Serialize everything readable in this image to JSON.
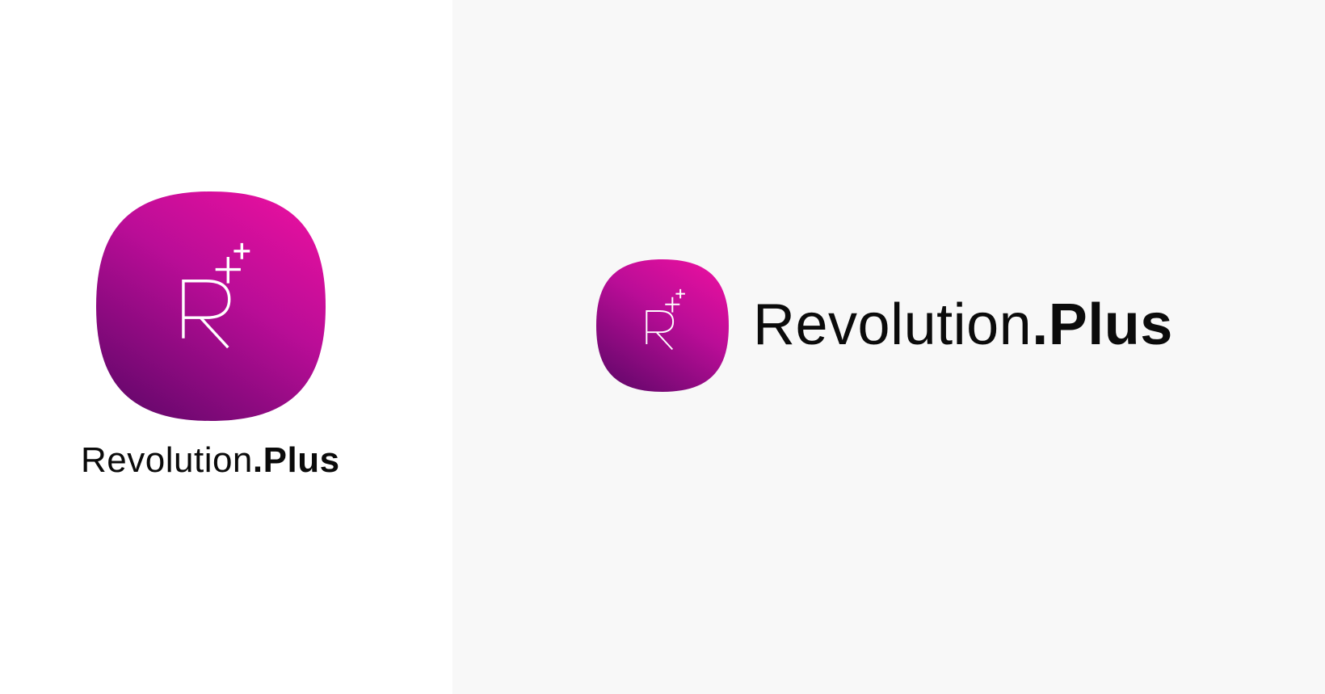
{
  "brand": {
    "name_regular": "Revolution",
    "name_bold": ".Plus",
    "icon_monogram": "R",
    "icon": "r-plus-squircle-logo",
    "gradient_colors": [
      "#e8109f",
      "#ba0d97",
      "#6e0870"
    ],
    "monogram_color": "#ffffff"
  },
  "panels": {
    "left_background": "#ffffff",
    "right_background": "#f8f8f8"
  }
}
